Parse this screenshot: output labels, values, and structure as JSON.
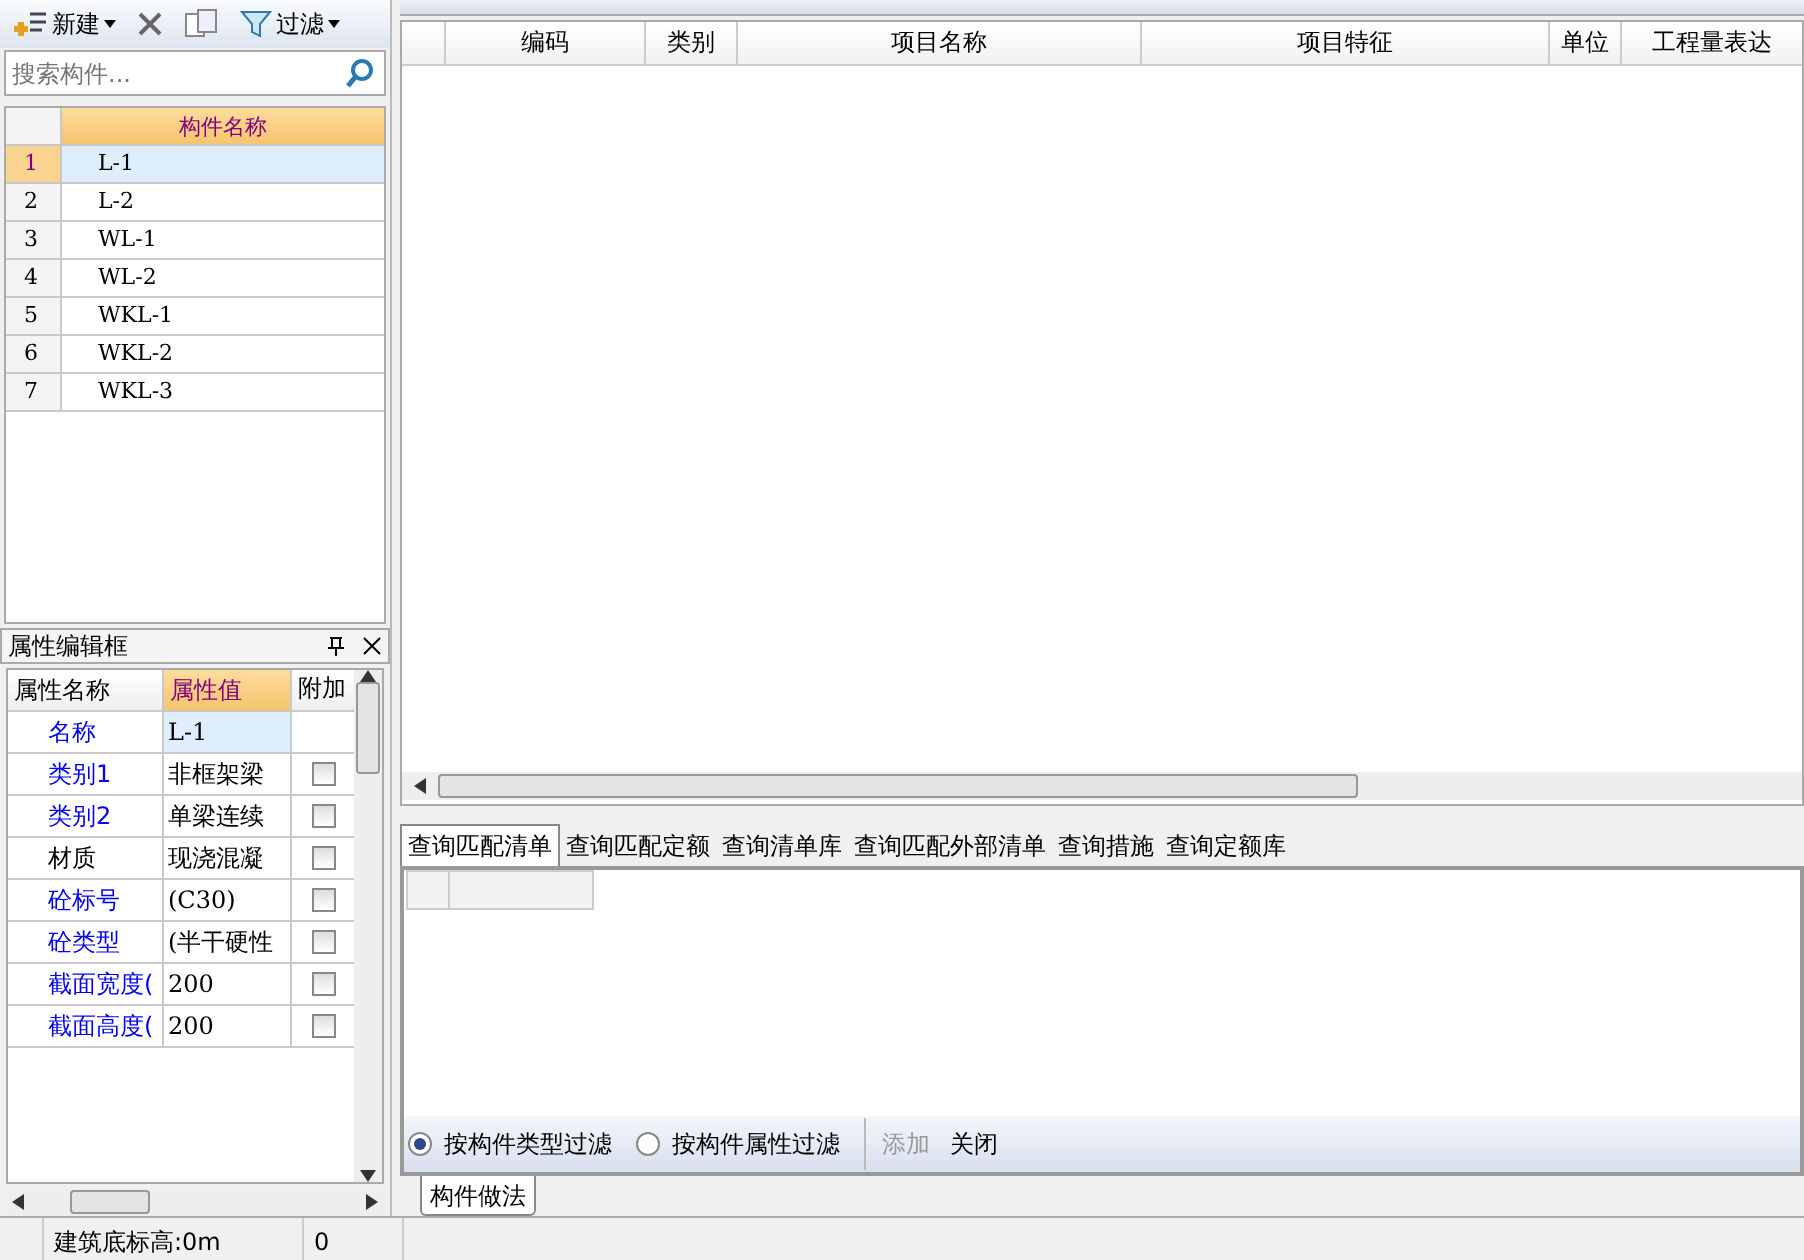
{
  "left_toolbar": {
    "items": [
      {
        "kind": "new",
        "label": "新建",
        "dropdown": true
      },
      {
        "kind": "delete"
      },
      {
        "kind": "copy"
      },
      {
        "kind": "filter",
        "label": "过滤",
        "dropdown": true
      }
    ]
  },
  "search": {
    "placeholder": "搜索构件..."
  },
  "component_list": {
    "column": "构件名称",
    "rows": [
      {
        "index": "1",
        "name": "L-1",
        "selected": true
      },
      {
        "index": "2",
        "name": "L-2",
        "selected": false
      },
      {
        "index": "3",
        "name": "WL-1",
        "selected": false
      },
      {
        "index": "4",
        "name": "WL-2",
        "selected": false
      },
      {
        "index": "5",
        "name": "WKL-1",
        "selected": false
      },
      {
        "index": "6",
        "name": "WKL-2",
        "selected": false
      },
      {
        "index": "7",
        "name": "WKL-3",
        "selected": false
      }
    ]
  },
  "property_panel": {
    "title": "属性编辑框",
    "columns": [
      "属性名称",
      "属性值",
      "附加"
    ],
    "rows": [
      {
        "name": "名称",
        "value": "L-1",
        "kind": "public",
        "selected": true
      },
      {
        "name": "类别1",
        "value": "非框架梁",
        "kind": "public",
        "selected": false,
        "checked": false
      },
      {
        "name": "类别2",
        "value": "单梁连续",
        "kind": "public",
        "selected": false,
        "checked": false
      },
      {
        "name": "材质",
        "value": "现浇混凝",
        "kind": "private",
        "selected": false,
        "checked": false
      },
      {
        "name": "砼标号",
        "value": "(C30)",
        "kind": "public",
        "selected": false,
        "checked": false
      },
      {
        "name": "砼类型",
        "value": "(半干硬性",
        "kind": "public",
        "selected": false,
        "checked": false
      },
      {
        "name": "截面宽度(",
        "value": "200",
        "kind": "public",
        "selected": false,
        "checked": false
      },
      {
        "name": "截面高度(",
        "value": "200",
        "kind": "public",
        "selected": false,
        "checked": false
      }
    ]
  },
  "bill_table": {
    "columns": [
      "编码",
      "类别",
      "项目名称",
      "项目特征",
      "单位",
      "工程量表达"
    ]
  },
  "query_tabs": [
    {
      "label": "查询匹配清单",
      "selected": true
    },
    {
      "label": "查询匹配定额",
      "selected": false
    },
    {
      "label": "查询清单库",
      "selected": false
    },
    {
      "label": "查询匹配外部清单",
      "selected": false
    },
    {
      "label": "查询措施",
      "selected": false
    },
    {
      "label": "查询定额库",
      "selected": false
    }
  ],
  "filter_bar": {
    "options": [
      {
        "label": "按构件类型过滤",
        "selected": true
      },
      {
        "label": "按构件属性过滤",
        "selected": false
      }
    ],
    "buttons": [
      {
        "label": "添加",
        "disabled": true
      },
      {
        "label": "关闭",
        "disabled": false
      }
    ]
  },
  "bottom_tabs": [
    {
      "label": "构件做法",
      "selected": true
    }
  ],
  "status_bar": [
    "建筑底标高:0m",
    "0"
  ]
}
